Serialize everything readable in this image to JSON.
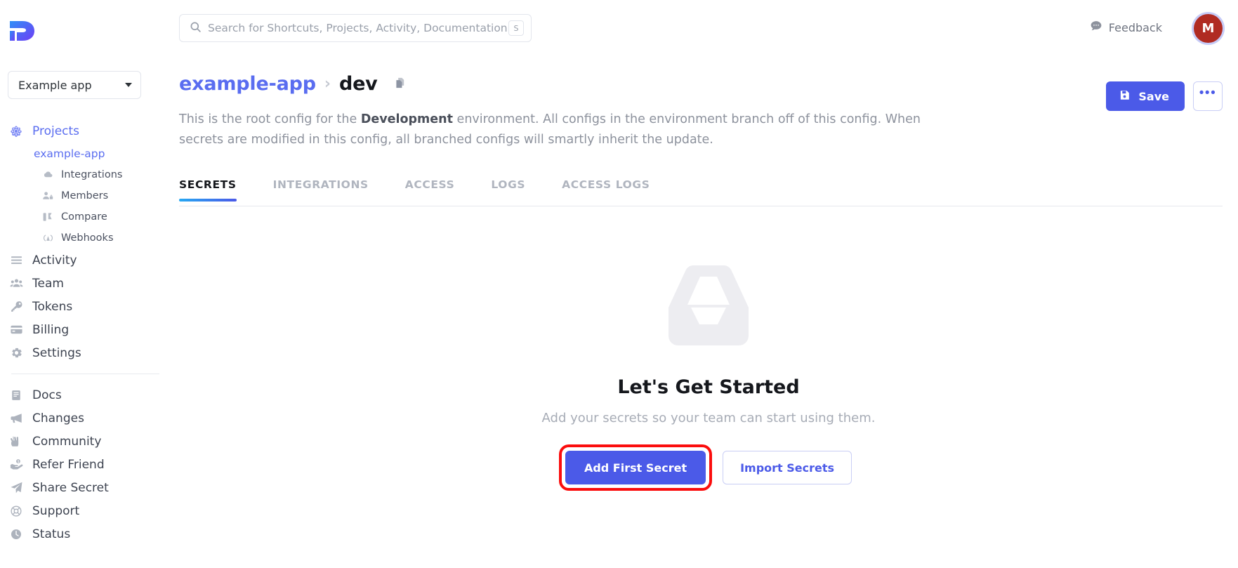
{
  "brand": {
    "logo_name": "doppler-logo",
    "accent": "#4b5ae8",
    "accent_light": "#5a6df0"
  },
  "sidebar": {
    "project_selector": {
      "value": "Example app"
    },
    "projects": {
      "label": "Projects",
      "icon": "atom-icon"
    },
    "current_project": {
      "label": "example-app"
    },
    "project_children": [
      {
        "label": "Integrations",
        "icon": "cloud-icon"
      },
      {
        "label": "Members",
        "icon": "members-icon"
      },
      {
        "label": "Compare",
        "icon": "compare-icon"
      },
      {
        "label": "Webhooks",
        "icon": "webhook-icon"
      }
    ],
    "primary_items": [
      {
        "label": "Activity",
        "icon": "list-icon"
      },
      {
        "label": "Team",
        "icon": "team-icon"
      },
      {
        "label": "Tokens",
        "icon": "key-icon"
      },
      {
        "label": "Billing",
        "icon": "card-icon"
      },
      {
        "label": "Settings",
        "icon": "gear-icon"
      }
    ],
    "secondary_items": [
      {
        "label": "Docs",
        "icon": "book-icon"
      },
      {
        "label": "Changes",
        "icon": "megaphone-icon"
      },
      {
        "label": "Community",
        "icon": "hand-peace-icon"
      },
      {
        "label": "Refer Friend",
        "icon": "hand-dollar-icon"
      },
      {
        "label": "Share Secret",
        "icon": "paper-plane-icon"
      },
      {
        "label": "Support",
        "icon": "lifebuoy-icon"
      },
      {
        "label": "Status",
        "icon": "clock-icon"
      }
    ]
  },
  "topbar": {
    "search": {
      "placeholder": "Search for Shortcuts, Projects, Activity, Documentation...",
      "value": "",
      "shortcut_key": "S",
      "icon": "search-icon"
    },
    "feedback": {
      "label": "Feedback",
      "icon": "comment-icon"
    },
    "avatar": {
      "initial": "M",
      "color": "#b02b22",
      "ring_color": "#c6cbf7"
    }
  },
  "header": {
    "breadcrumb": {
      "project": "example-app",
      "separator": "›",
      "config": "dev",
      "copy_icon": "copy-icon"
    },
    "description_prefix": "This is the root config for the ",
    "description_bold": "Development",
    "description_suffix": " environment. All configs in the environment branch off of this config. When secrets are modified in this config, all branched configs will smartly inherit the update.",
    "save_button": {
      "label": "Save",
      "icon": "floppy-disk-icon"
    },
    "more_button": {
      "label": "•••",
      "icon": "ellipsis-icon"
    }
  },
  "tabs": [
    {
      "label": "SECRETS",
      "active": true
    },
    {
      "label": "INTEGRATIONS",
      "active": false
    },
    {
      "label": "ACCESS",
      "active": false
    },
    {
      "label": "LOGS",
      "active": false
    },
    {
      "label": "ACCESS LOGS",
      "active": false
    }
  ],
  "empty_state": {
    "icon": "inbox-tray-icon",
    "title": "Let's Get Started",
    "subtitle": "Add your secrets so your team can start using them.",
    "primary_button": {
      "label": "Add First Secret",
      "highlighted": true,
      "highlight_color": "#fb0d0d"
    },
    "secondary_button": {
      "label": "Import Secrets"
    }
  }
}
